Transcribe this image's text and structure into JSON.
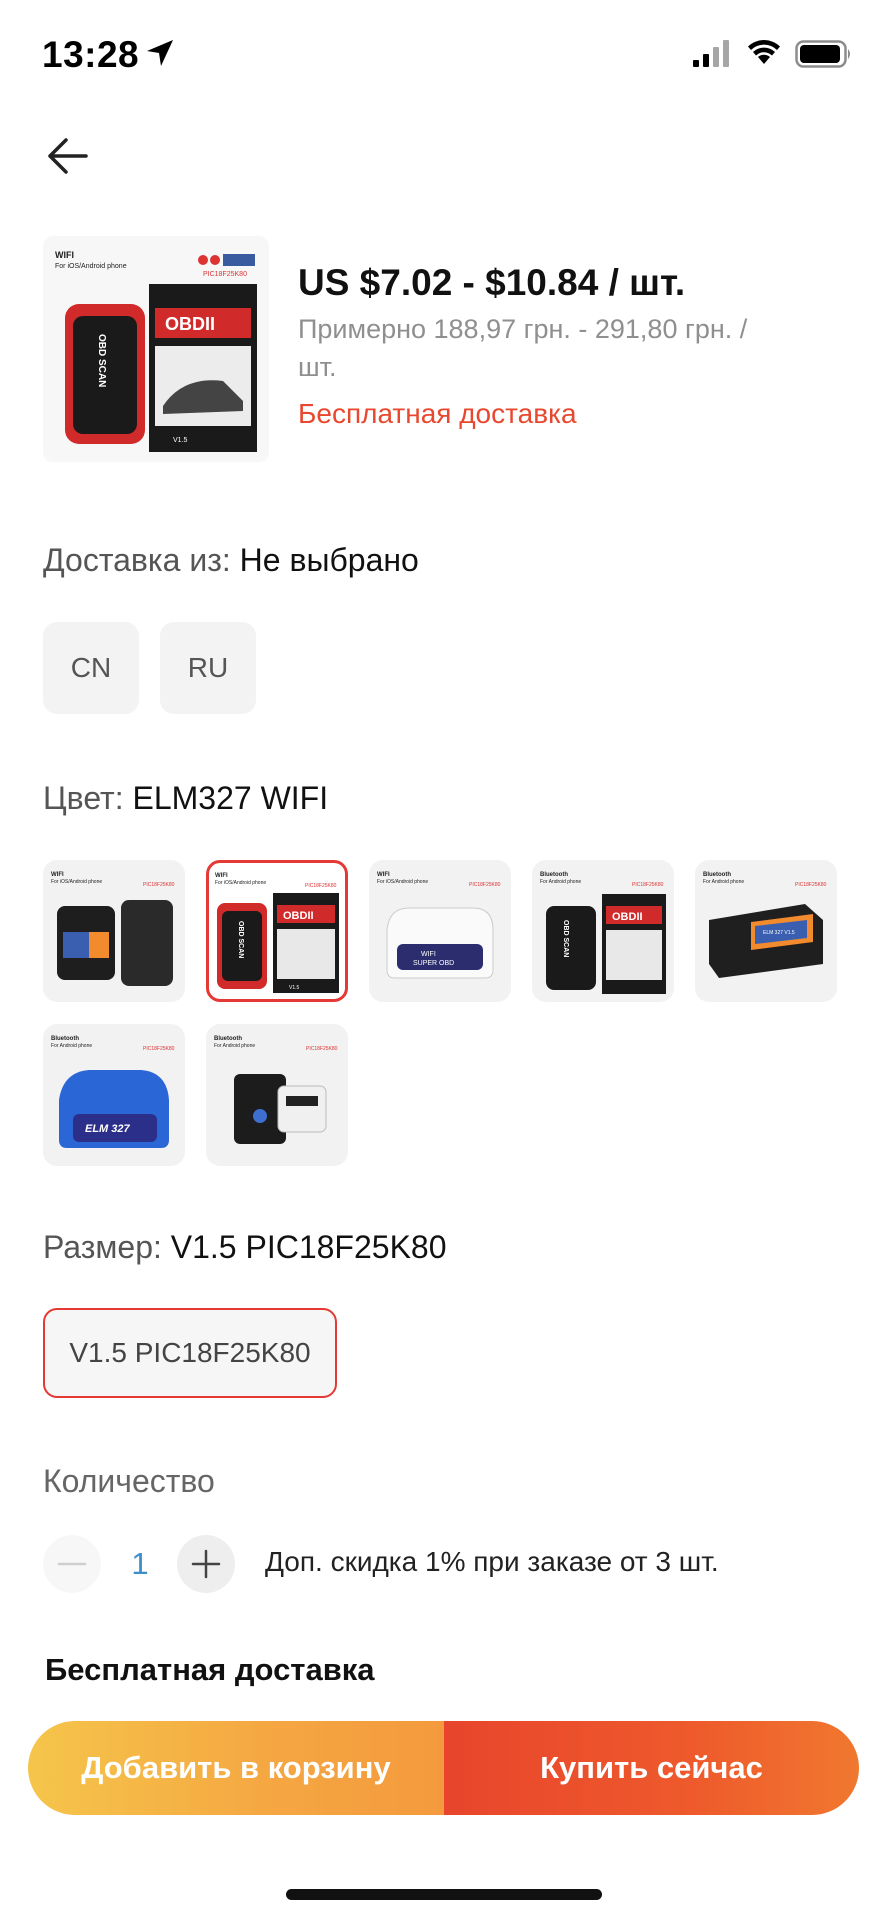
{
  "status_bar": {
    "time": "13:28"
  },
  "product": {
    "price_range": "US $7.02 - $10.84 / шт.",
    "price_approx": "Примерно 188,97 грн. - 291,80 грн. / шт.",
    "free_shipping": "Бесплатная доставка",
    "thumb_text": {
      "wifi": "WIFI",
      "platform": "For iOS/Android phone",
      "model": "PIC18F25K80",
      "brand": "OBDII",
      "device": "OBD SCAN",
      "version": "V1.5"
    }
  },
  "ship_from": {
    "label": "Доставка из:",
    "value": "Не выбрано",
    "options": [
      "CN",
      "RU"
    ]
  },
  "color": {
    "label": "Цвет:",
    "value": "ELM327 WIFI",
    "swatch_texts": {
      "wifi": "WIFI",
      "ios_android": "For iOS/Android phone",
      "bt": "Bluetooth",
      "android": "For Android phone",
      "pic": "PIC18F25K80",
      "obdii": "OBDII",
      "obd_scan": "OBD SCAN",
      "super_obd": "SUPER OBD",
      "elm_v15": "ELM 327 V1.5",
      "elm327": "ELM 327",
      "ver_v15": "V1.5"
    }
  },
  "size": {
    "label": "Размер:",
    "value": "V1.5 PIC18F25K80",
    "option": "V1.5 PIC18F25K80"
  },
  "quantity": {
    "label": "Количество",
    "value": "1",
    "discount_note": "Доп. скидка 1% при заказе от 3 шт."
  },
  "shipping_footer": "Бесплатная доставка",
  "actions": {
    "add_to_cart": "Добавить в корзину",
    "buy_now": "Купить сейчас"
  },
  "colors": {
    "accent": "#e8482f",
    "selected_border": "#e53935",
    "qty_blue": "#3d8ec9"
  },
  "icons": [
    "location-arrow-icon",
    "cellular-signal-icon",
    "wifi-icon",
    "battery-icon",
    "back-arrow-icon",
    "minus-icon",
    "plus-icon"
  ]
}
